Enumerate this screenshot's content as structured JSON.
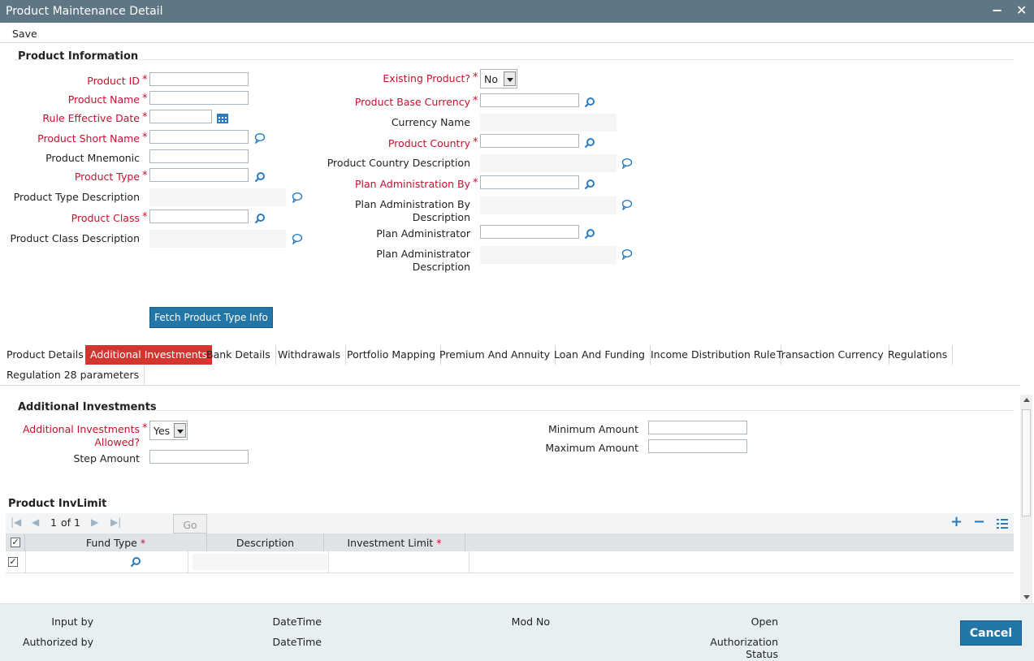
{
  "window": {
    "title": "Product Maintenance Detail",
    "minimize": "−",
    "close": "✕"
  },
  "menu": {
    "save": "Save"
  },
  "product_info": {
    "section_title": "Product Information",
    "product_id": "Product ID",
    "product_name": "Product Name",
    "rule_effective_date": "Rule Effective Date",
    "product_short_name": "Product Short Name",
    "product_mnemonic": "Product Mnemonic",
    "product_type": "Product Type",
    "product_type_description": "Product Type Description",
    "product_class": "Product Class",
    "product_class_description": "Product Class Description",
    "existing_product": "Existing Product?",
    "existing_product_value": "No",
    "product_base_currency": "Product Base Currency",
    "currency_name": "Currency Name",
    "product_country": "Product Country",
    "product_country_description": "Product Country Description",
    "plan_administration_by": "Plan Administration By",
    "plan_administration_by_description_1": "Plan Administration By",
    "plan_administration_by_description_2": "Description",
    "plan_administrator": "Plan Administrator",
    "plan_administrator_description_1": "Plan Administrator",
    "plan_administrator_description_2": "Description",
    "fetch_button": "Fetch Product Type Info",
    "required_mark": "*"
  },
  "tabs": [
    "Product Details",
    "Additional Investments",
    "Bank Details",
    "Withdrawals",
    "Portfolio Mapping",
    "Premium And Annuity",
    "Loan And Funding",
    "Income Distribution Rule",
    "Transaction Currency",
    "Regulations",
    "Regulation 28 parameters"
  ],
  "additional_investments": {
    "section_title": "Additional Investments",
    "allowed_1": "Additional Investments",
    "allowed_2": "Allowed?",
    "allowed_value": "Yes",
    "step_amount": "Step Amount",
    "minimum_amount": "Minimum Amount",
    "maximum_amount": "Maximum Amount"
  },
  "inv_limit": {
    "section_title": "Product InvLimit",
    "page_current": "1",
    "page_of": "of 1",
    "go": "Go",
    "columns": [
      "Fund Type",
      "Description",
      "Investment Limit"
    ],
    "required_mark": "*"
  },
  "footer": {
    "input_by": "Input by",
    "authorized_by": "Authorized by",
    "datetime_1": "DateTime",
    "datetime_2": "DateTime",
    "mod_no": "Mod No",
    "open": "Open",
    "authorization": "Authorization",
    "status": "Status",
    "cancel": "Cancel"
  },
  "colors": {
    "titlebar": "#5f7684",
    "required": "#c8102e",
    "active_tab": "#d3362f",
    "button": "#2376a8",
    "lookup_icon": "#2a7bbf"
  }
}
